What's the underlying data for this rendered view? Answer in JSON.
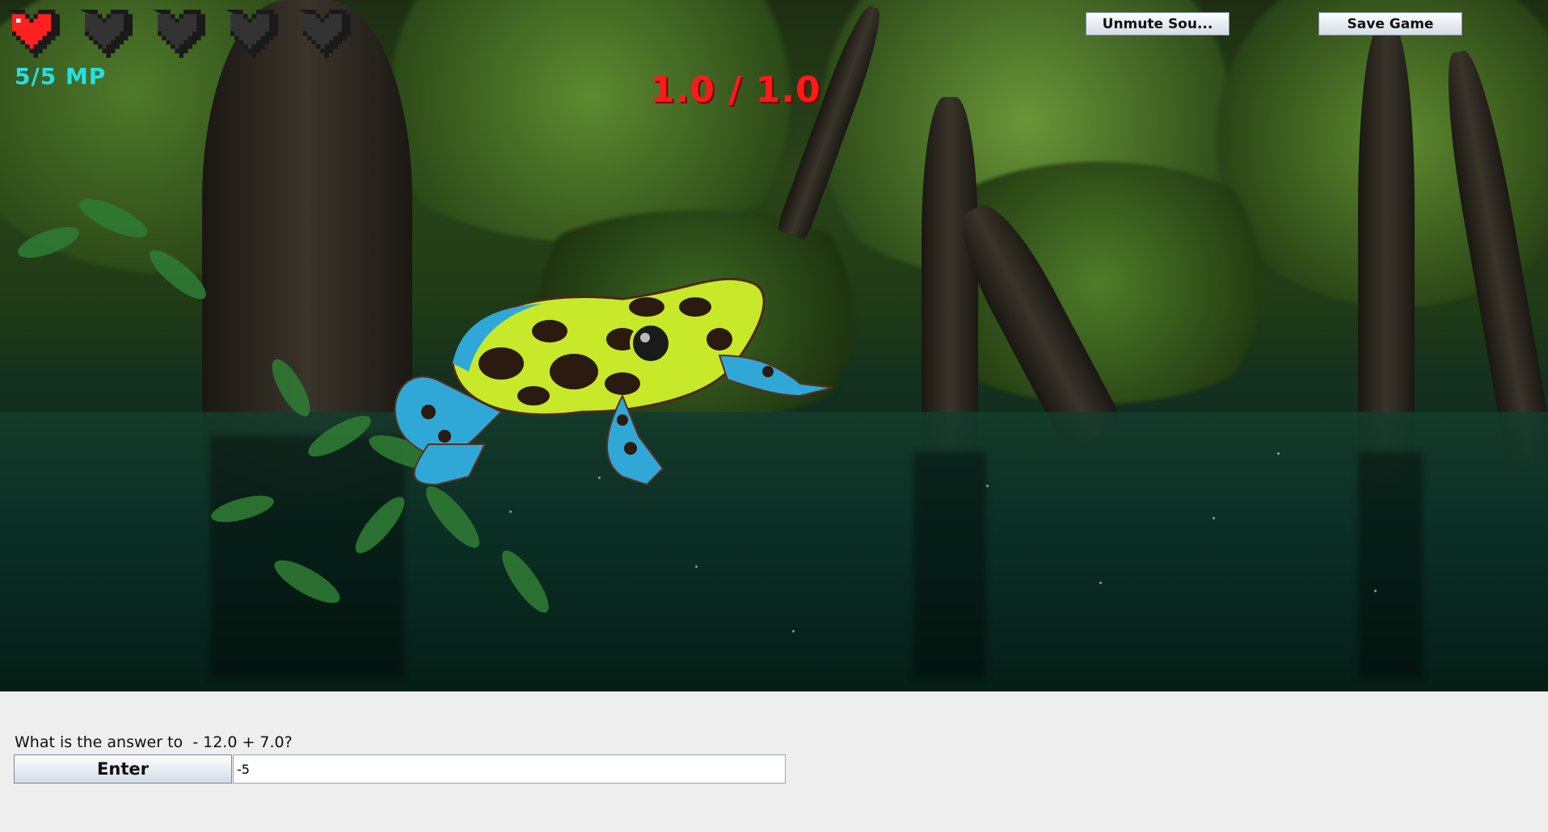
{
  "hud": {
    "hearts": [
      {
        "state": "full",
        "icon": "heart-full-icon"
      },
      {
        "state": "empty",
        "icon": "heart-empty-icon"
      },
      {
        "state": "empty",
        "icon": "heart-empty-icon"
      },
      {
        "state": "empty",
        "icon": "heart-empty-icon"
      },
      {
        "state": "empty",
        "icon": "heart-empty-icon"
      }
    ],
    "mp_text": "5/5 MP",
    "enemy_hp_text": "1.0 / 1.0"
  },
  "buttons": {
    "mute_label": "Unmute Sou...",
    "save_label": "Save Game"
  },
  "scene": {
    "enemy": "frog-icon"
  },
  "panel": {
    "question": "What is the answer to  - 12.0 + 7.0?",
    "enter_label": "Enter",
    "answer_value": "-5"
  },
  "colors": {
    "heart_full": "#ff2020",
    "heart_empty": "#333333",
    "mp": "#24e0e6",
    "hp_ratio": "#ff1a1a"
  }
}
